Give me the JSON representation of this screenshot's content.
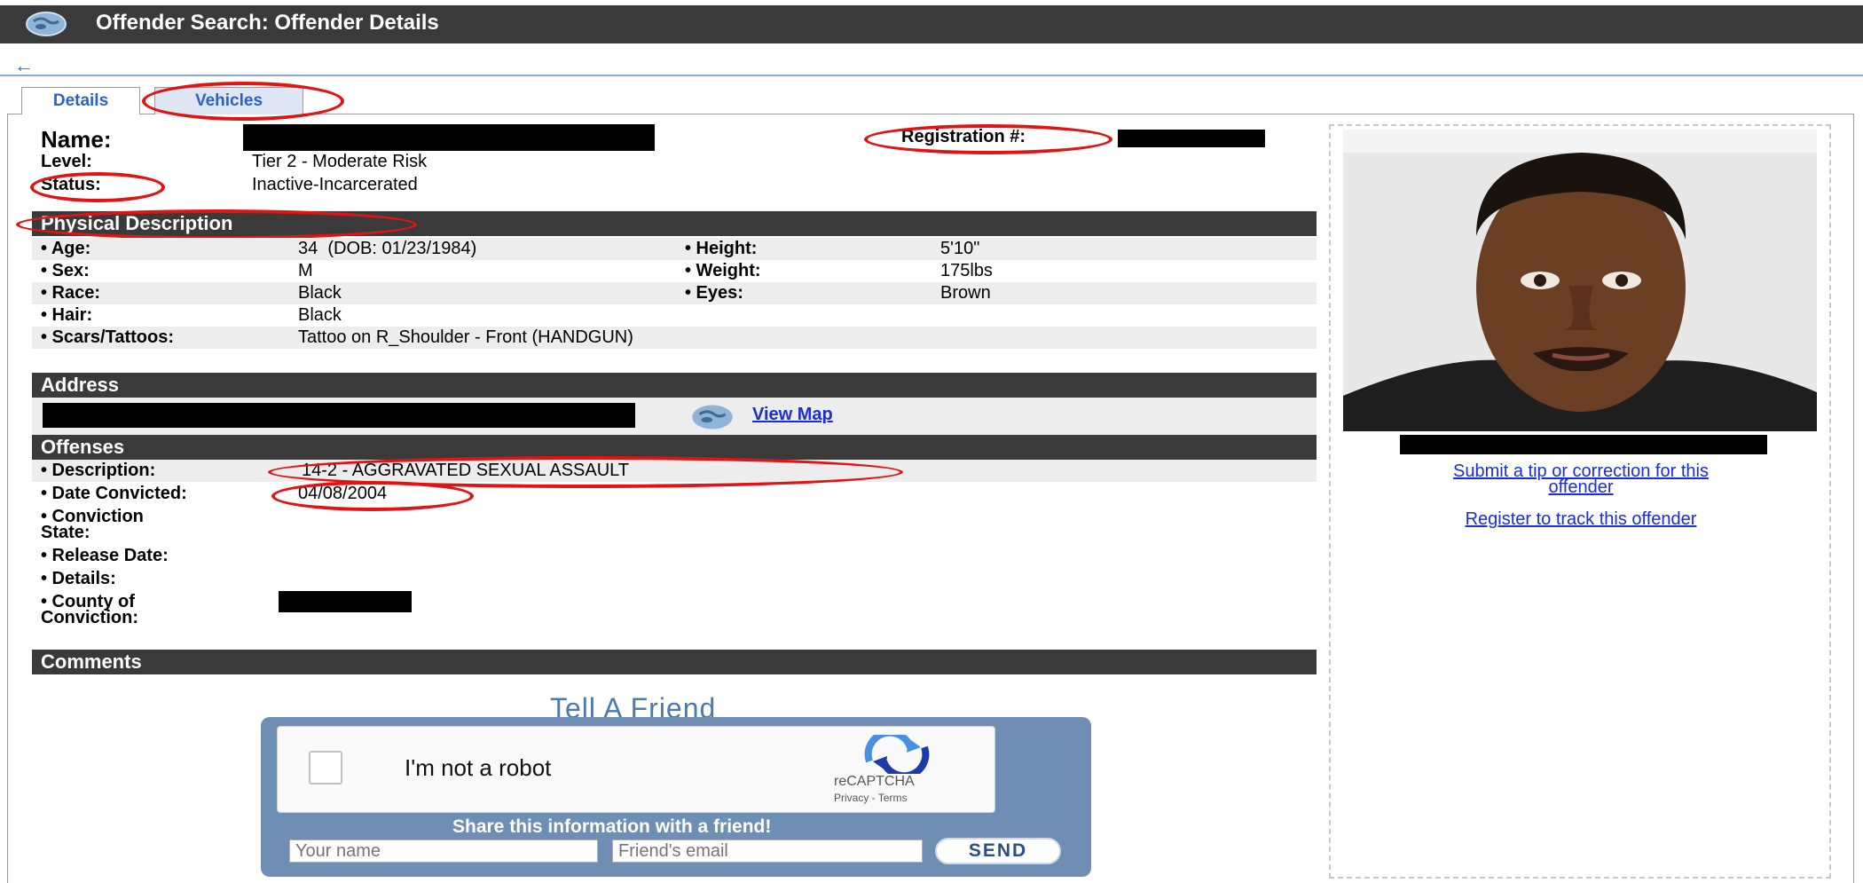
{
  "header": {
    "title": "Offender Search: Offender Details",
    "back_icon": "back-arrow-icon",
    "globe_icon": "globe-icon"
  },
  "tabs": [
    {
      "label": "Details",
      "active": true
    },
    {
      "label": "Vehicles",
      "active": false
    }
  ],
  "summary": {
    "name_label": "Name:",
    "registration_label": "Registration #:",
    "level_label": "Level:",
    "level_value": "Tier 2 - Moderate Risk",
    "status_label": "Status:",
    "status_value": "Inactive-Incarcerated"
  },
  "physical": {
    "title": "Physical Description",
    "age_label": "• Age:",
    "age_value": "34  (DOB: 01/23/1984)",
    "sex_label": "• Sex:",
    "sex_value": "M",
    "race_label": "• Race:",
    "race_value": "Black",
    "hair_label": "• Hair:",
    "hair_value": "Black",
    "scars_label": "• Scars/Tattoos:",
    "scars_value": "Tattoo on R_Shoulder - Front (HANDGUN)",
    "height_label": "• Height:",
    "height_value": "5'10\"",
    "weight_label": "• Weight:",
    "weight_value": "175lbs",
    "eyes_label": "• Eyes:",
    "eyes_value": "Brown"
  },
  "address": {
    "title": "Address",
    "map_link": "View Map"
  },
  "offenses": {
    "title": "Offenses",
    "description_label": "• Description:",
    "description_value": "14-2 - AGGRAVATED SEXUAL ASSAULT",
    "date_label": "• Date Convicted:",
    "date_value": "04/08/2004",
    "state_label_1": "• Conviction",
    "state_label_2": "State:",
    "release_label": "• Release Date:",
    "details_label": "• Details:",
    "county_label_1": "• County of",
    "county_label_2": "Conviction:"
  },
  "comments": {
    "title": "Comments"
  },
  "side": {
    "tip_link_1": "Submit a tip or correction for this",
    "tip_link_2": "offender",
    "track_link": "Register to track this offender"
  },
  "tell_friend": {
    "heading": "Tell A Friend",
    "captcha_label": "I'm not a robot",
    "recaptcha_name": "reCAPTCHA",
    "recaptcha_terms": "Privacy - Terms",
    "share_text": "Share this information with a friend!",
    "name_placeholder": "Your name",
    "email_placeholder": "Friend's email",
    "send_label": "SEND"
  },
  "colors": {
    "header_bg": "#3a3a3a",
    "section_bg": "#3a3a3a",
    "link": "#1a2dd6",
    "tab_text": "#2b63c4",
    "annotation_red": "#e01414",
    "widget_bg": "#6f8eb4"
  }
}
